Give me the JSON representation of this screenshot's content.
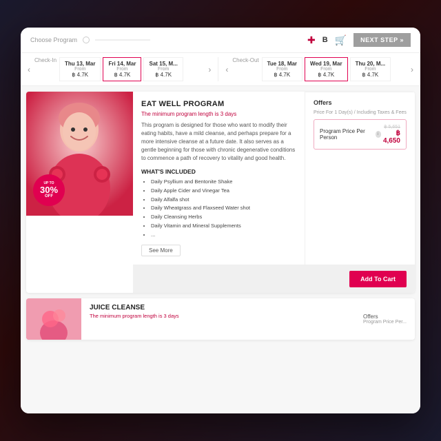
{
  "nav": {
    "label": "Choose Program",
    "next_step": "NEXT STEP »",
    "lang": "B",
    "progress_label": ""
  },
  "checkin": {
    "label": "Check-In",
    "dates": [
      {
        "day": "Thu 13, Mar",
        "from": "From",
        "price": "฿ 4.7K"
      },
      {
        "day": "Fri 14, Mar",
        "from": "From",
        "price": "฿ 4.7K"
      },
      {
        "day": "Sat 15, M...",
        "from": "From",
        "price": "฿ 4.7K"
      }
    ]
  },
  "checkout": {
    "label": "Check-Out",
    "dates": [
      {
        "day": "Tue 18, Mar",
        "from": "From",
        "price": "฿ 4.7K"
      },
      {
        "day": "Wed 19, Mar",
        "from": "From",
        "price": "฿ 4.7K"
      },
      {
        "day": "Thu 20, M...",
        "from": "From",
        "price": "฿ 4.7K"
      }
    ]
  },
  "program": {
    "title": "EAT WELL PROGRAM",
    "min_length": "The minimum program length is 3 days",
    "description": "This program is designed for those who want to modify their eating habits, have a mild cleanse, and perhaps prepare for a more intensive cleanse at a future date. It also serves as a gentle beginning for those with chronic degenerative conditions to commence a path of recovery to vitality and good health.",
    "whats_included": "WHAT'S INCLUDED",
    "included_items": [
      "Daily Psyllium and Bentonite Shake",
      "Daily Apple Cider and Vinegar Tea",
      "Daily Alfalfa shot",
      "Daily Wheatgrass and Flaxseed Water shot",
      "Daily Cleansing Herbs",
      "Daily Vitamin and Mineral Supplements",
      "..."
    ],
    "see_more": "See More",
    "discount": {
      "up_to": "UP TO",
      "pct": "30%",
      "off": "OFF"
    }
  },
  "offers": {
    "title": "Offers",
    "price_label": "Price For 1 Day(s) / Including Taxes & Fees",
    "offer_label": "Program Price Per Person",
    "original_price": "฿ 5,651",
    "new_price": "฿ 4,650"
  },
  "add_to_cart": "Add To Cart",
  "juice_cleanse": {
    "title": "JUICE CLEANSE",
    "min_length": "The minimum program length is 3 days",
    "offers_title": "Offers",
    "price_label": "Program Price Per..."
  }
}
